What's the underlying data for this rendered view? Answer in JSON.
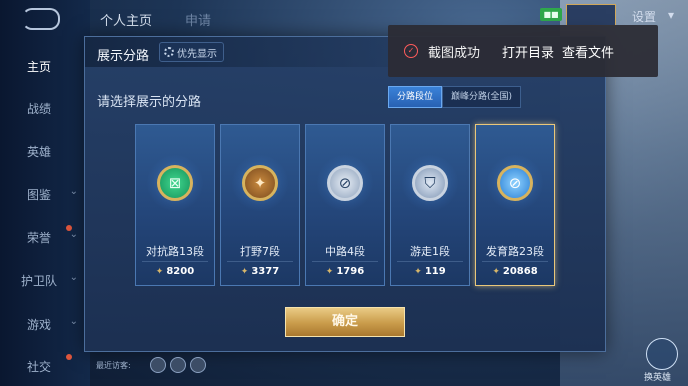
{
  "topnav": {
    "tabs": [
      "个人主页",
      "申请"
    ],
    "settings_label": "设置",
    "flag_text": "■■"
  },
  "sidebar": {
    "items": [
      {
        "label": "主页",
        "active": true
      },
      {
        "label": "战绩"
      },
      {
        "label": "英雄"
      },
      {
        "label": "图鉴"
      },
      {
        "label": "荣誉"
      },
      {
        "label": "护卫队"
      },
      {
        "label": "游戏"
      },
      {
        "label": "社交"
      }
    ]
  },
  "panel": {
    "title": "展示分路",
    "priority_label": "优先显示",
    "prompt": "请选择展示的分路",
    "tabs": [
      "分路段位",
      "巅峰分路(全国)"
    ],
    "active_tab": 0,
    "cards": [
      {
        "label": "对抗路13段",
        "score": "8200",
        "emblem": "green",
        "icon": "⊠",
        "selected": false
      },
      {
        "label": "打野7段",
        "score": "3377",
        "emblem": "gold",
        "icon": "✦",
        "selected": false
      },
      {
        "label": "中路4段",
        "score": "1796",
        "emblem": "silver",
        "icon": "⊘",
        "selected": false
      },
      {
        "label": "游走1段",
        "score": "119",
        "emblem": "silver2",
        "icon": "⛉",
        "selected": false
      },
      {
        "label": "发育路23段",
        "score": "20868",
        "emblem": "blue",
        "icon": "⊘",
        "selected": true
      }
    ],
    "confirm_label": "确定"
  },
  "toast": {
    "message": "截图成功",
    "open_dir": "打开目录",
    "view_file": "查看文件"
  },
  "bottom": {
    "recent_label": "最近访客:",
    "hero_label": "换英雄"
  },
  "colors": {
    "panel_bg": "#24467a",
    "accent_blue": "#2861b4",
    "gold": "#c99b4a",
    "toast_icon": "#ff5b5b"
  }
}
